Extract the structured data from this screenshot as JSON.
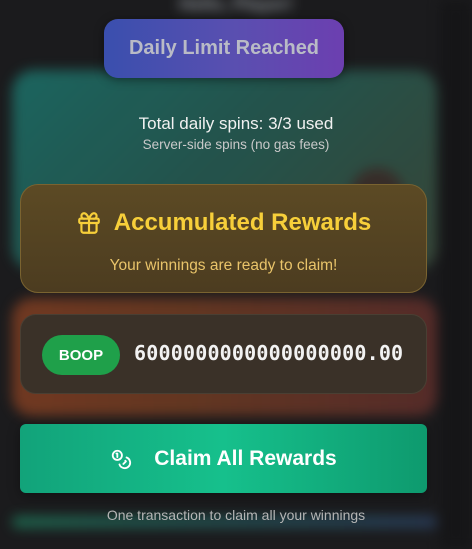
{
  "background": {
    "header_text": "Hello, Player!"
  },
  "badge": {
    "label": "Daily Limit Reached"
  },
  "spins": {
    "total_text": "Total daily spins: 3/3 used",
    "subtext": "Server-side spins (no gas fees)"
  },
  "rewards": {
    "icon": "gift-icon",
    "title": "Accumulated Rewards",
    "subtitle": "Your winnings are ready to claim!"
  },
  "amount": {
    "token": "BOOP",
    "value": "6000000000000000000.00"
  },
  "claim": {
    "icon": "coins-icon",
    "label": "Claim All Rewards",
    "note": "One transaction to claim all your winnings"
  },
  "colors": {
    "accent_gold": "#f7cf3a",
    "claim_green": "#16c08c",
    "token_green": "#1fa04a"
  }
}
